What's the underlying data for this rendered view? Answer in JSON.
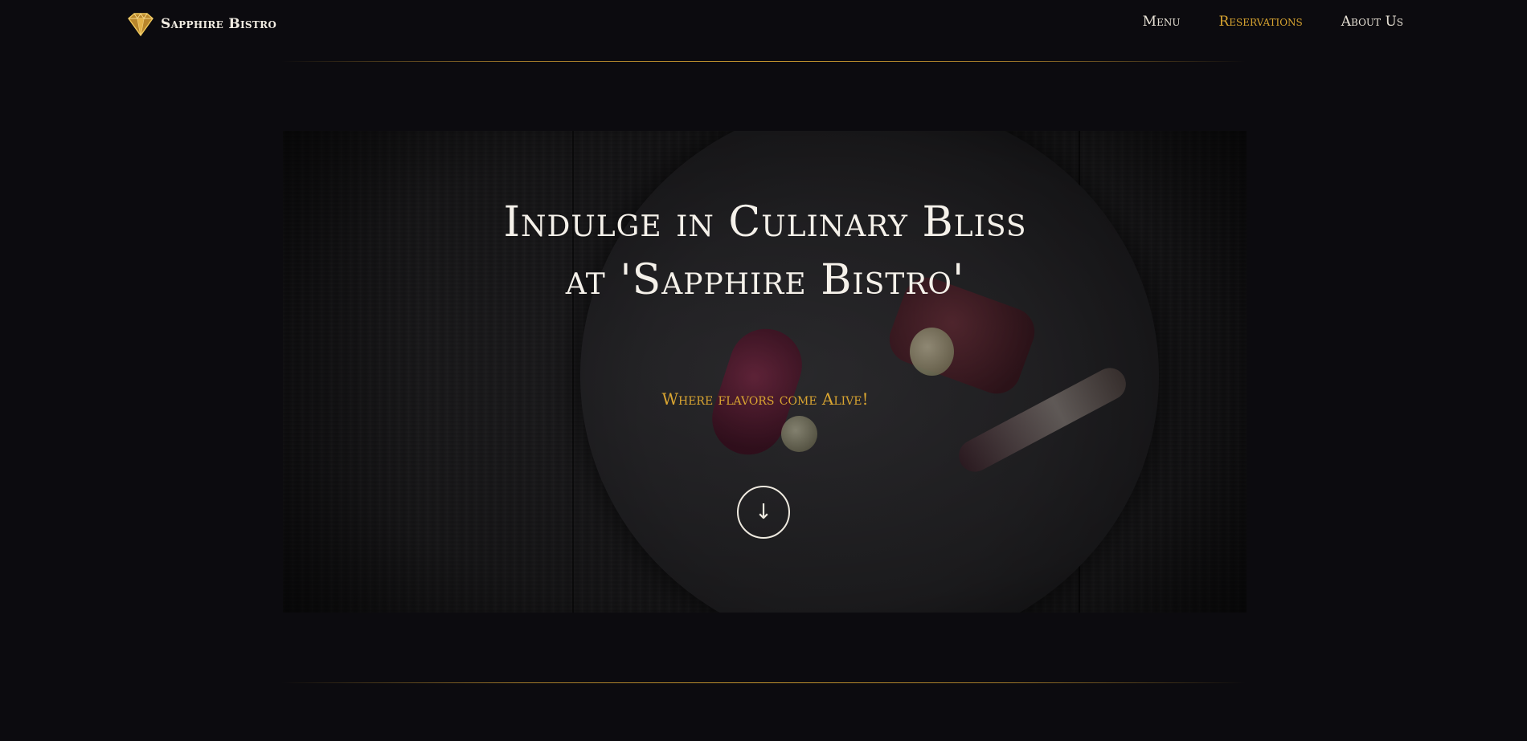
{
  "header": {
    "brand_name": "Sapphire Bistro",
    "logo_icon": "diamond-logo-icon",
    "nav": [
      {
        "label": "Menu",
        "active": false
      },
      {
        "label": "Reservations",
        "active": true
      },
      {
        "label": "About Us",
        "active": false
      }
    ]
  },
  "hero": {
    "headline": "Indulge in Culinary Bliss at 'Sapphire Bistro'",
    "tagline": "Where flavors come Alive!",
    "scroll_icon": "↓"
  },
  "colors": {
    "background": "#0c0b0f",
    "accent": "#d9a531",
    "text": "#f5f1ea"
  }
}
